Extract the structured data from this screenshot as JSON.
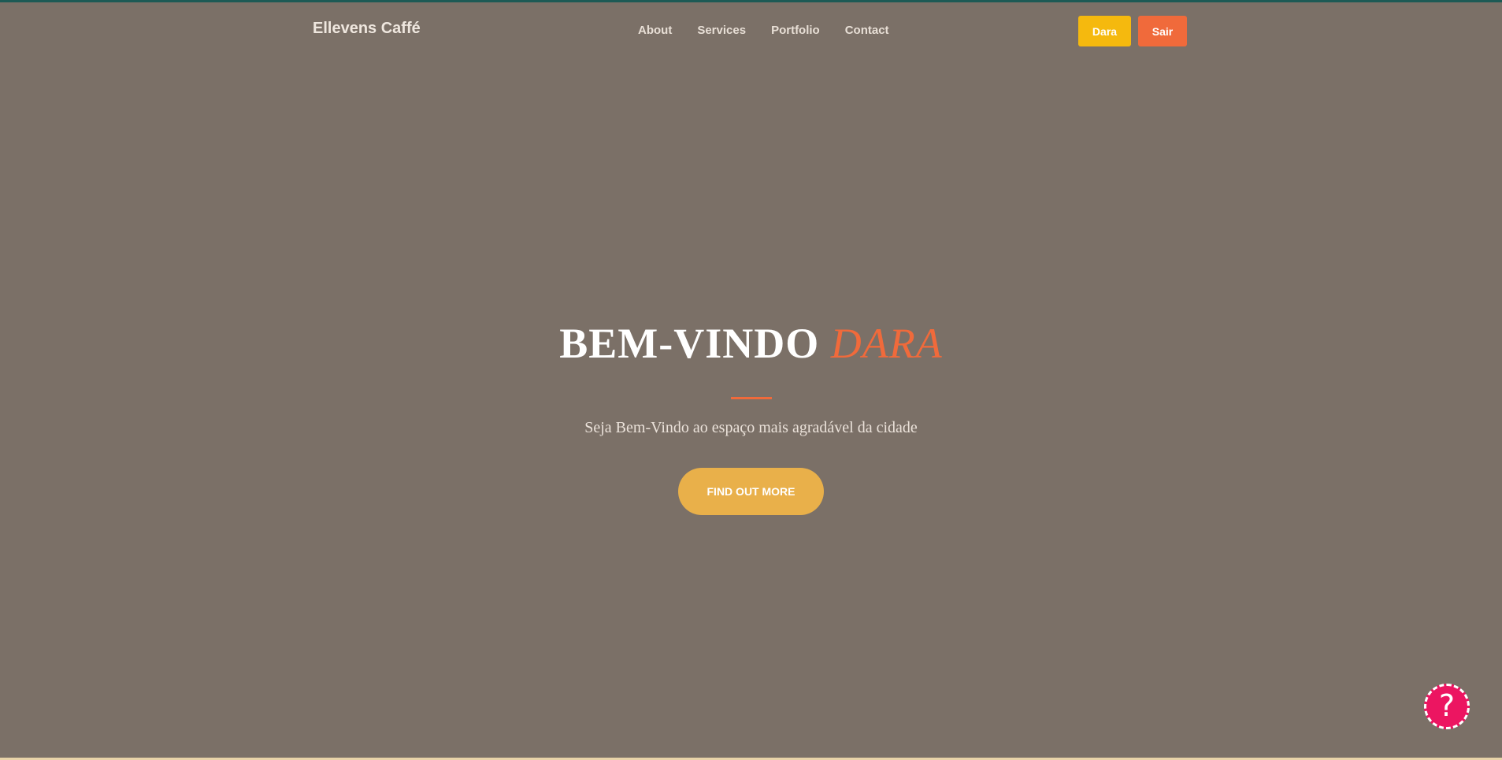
{
  "navbar": {
    "brand": "Ellevens Caffé",
    "links": [
      "About",
      "Services",
      "Portfolio",
      "Contact"
    ],
    "user_button": "Dara",
    "exit_button": "Sair"
  },
  "hero": {
    "title_prefix": "BEM-VINDO",
    "title_name": "DARA",
    "subtitle": "Seja Bem-Vindo ao espaço mais agradável da cidade",
    "cta_label": "FIND OUT MORE"
  },
  "help_widget": {
    "symbol": "?",
    "icon": "question-icon"
  },
  "colors": {
    "background": "#7b7067",
    "accent_orange": "#f06a3b",
    "accent_yellow": "#f5b90e",
    "cta": "#e9b04a",
    "help": "#ec1561"
  }
}
